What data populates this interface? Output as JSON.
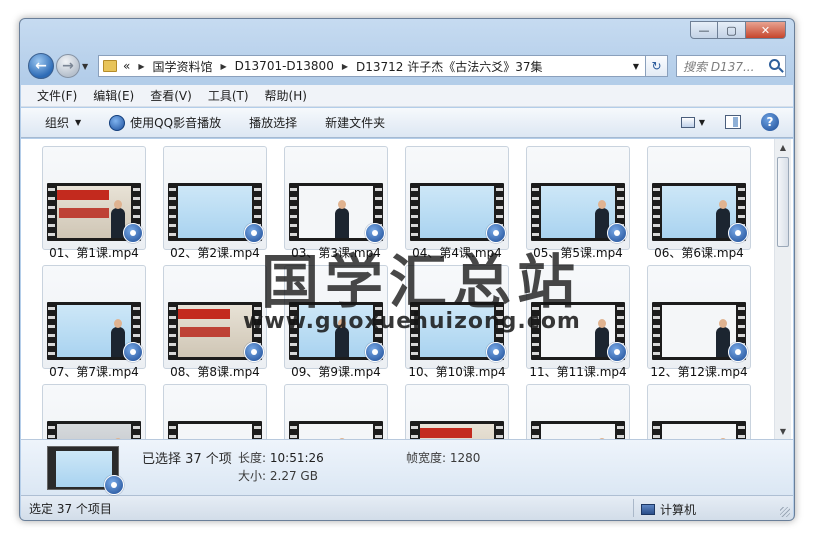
{
  "window": {
    "caption_buttons": [
      "—",
      "▢",
      "✕"
    ]
  },
  "address": {
    "prefix": "«",
    "crumbs": [
      "国学资料馆",
      "D13701-D13800",
      "D13712 许子杰《古法六爻》37集"
    ]
  },
  "search": {
    "placeholder": "搜索 D137..."
  },
  "menubar": [
    "文件(F)",
    "编辑(E)",
    "查看(V)",
    "工具(T)",
    "帮助(H)"
  ],
  "toolbar": {
    "organize": "组织",
    "play_qq": "使用QQ影音播放",
    "playlist": "播放选择",
    "new_folder": "新建文件夹"
  },
  "files": [
    {
      "label": "01、第1课.mp4",
      "thumb": "title"
    },
    {
      "label": "02、第2课.mp4",
      "thumb": "blue"
    },
    {
      "label": "03、第3课.mp4",
      "thumb": "white"
    },
    {
      "label": "04、第4课.mp4",
      "thumb": "blue"
    },
    {
      "label": "05、第5课.mp4",
      "thumb": "blue"
    },
    {
      "label": "06、第6课.mp4",
      "thumb": "blue"
    },
    {
      "label": "07、第7课.mp4",
      "thumb": "blue"
    },
    {
      "label": "08、第8课.mp4",
      "thumb": "title"
    },
    {
      "label": "09、第9课.mp4",
      "thumb": "blue"
    },
    {
      "label": "10、第10课.mp4",
      "thumb": "blue"
    },
    {
      "label": "11、第11课.mp4",
      "thumb": "white"
    },
    {
      "label": "12、第12课.mp4",
      "thumb": "white"
    },
    {
      "label": "",
      "thumb": "gray"
    },
    {
      "label": "",
      "thumb": "white"
    },
    {
      "label": "",
      "thumb": "white"
    },
    {
      "label": "",
      "thumb": "title"
    },
    {
      "label": "",
      "thumb": "white"
    },
    {
      "label": "",
      "thumb": "white"
    }
  ],
  "watermark": {
    "text": "国学汇总站",
    "url": "www.guoxuehuizong.com"
  },
  "details": {
    "selected": "已选择 37 个项",
    "length_label": "长度:",
    "length_value": "10:51:26",
    "size_label": "大小:",
    "size_value": "2.27 GB",
    "frame_width_label": "帧宽度:",
    "frame_width_value": "1280"
  },
  "status": {
    "left": "选定 37 个项目",
    "right": "计算机"
  }
}
